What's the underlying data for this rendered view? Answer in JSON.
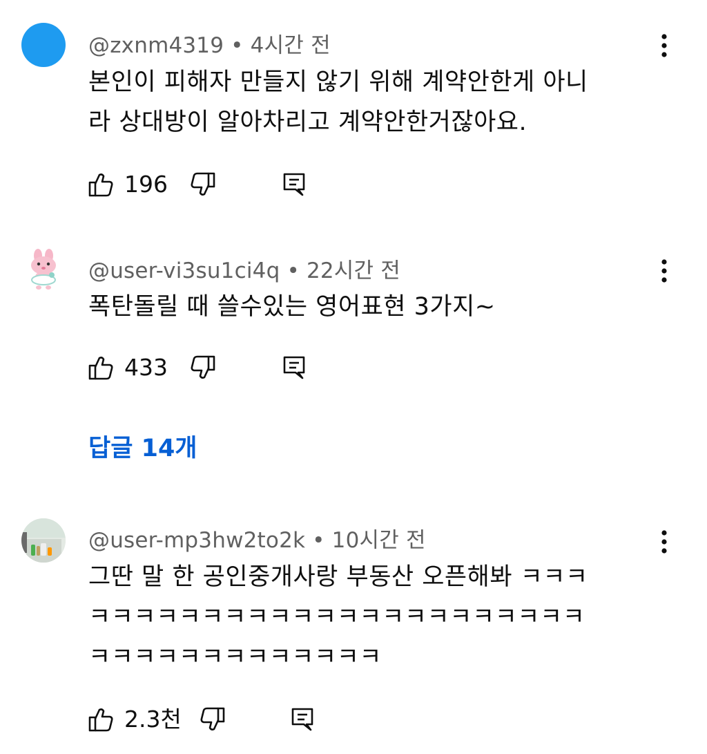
{
  "comments": [
    {
      "author": "@zxnm4319",
      "separator": "•",
      "time": "4시간 전",
      "lines": [
        "본인이 피해자 만들지 않기 위해 계약안한게 아니",
        "라 상대방이 알아차리고 계약안한거잖아요."
      ],
      "likes": "196",
      "avatar_color": "#1e9bf0",
      "avatar_kind": "solid-blue-circle"
    },
    {
      "author": "@user-vi3su1ci4q",
      "separator": "•",
      "time": "22시간 전",
      "lines": [
        "폭탄돌릴 때 쓸수있는 영어표현 3가지~"
      ],
      "likes": "433",
      "avatar_kind": "pink-bunny-character"
    },
    {
      "author": "@user-mp3hw2to2k",
      "separator": "•",
      "time": "10시간 전",
      "lines": [
        "그딴 말 한 공인중개사랑 부동산 오픈해봐 ㅋㅋㅋ",
        "ㅋㅋㅋㅋㅋㅋㅋㅋㅋㅋㅋㅋㅋㅋㅋㅋㅋㅋㅋㅋㅋㅋ",
        "ㅋㅋㅋㅋㅋㅋㅋㅋㅋㅋㅋㅋㅋ"
      ],
      "likes": "2.3천",
      "avatar_kind": "photo-room"
    }
  ],
  "replies_link": "답글 14개",
  "colors": {
    "accent": "#065fd4",
    "meta_text": "#606060",
    "body_text": "#0f0f0f"
  },
  "icons": [
    "thumb-up-icon",
    "thumb-down-icon",
    "reply-icon",
    "more-vert-icon"
  ]
}
